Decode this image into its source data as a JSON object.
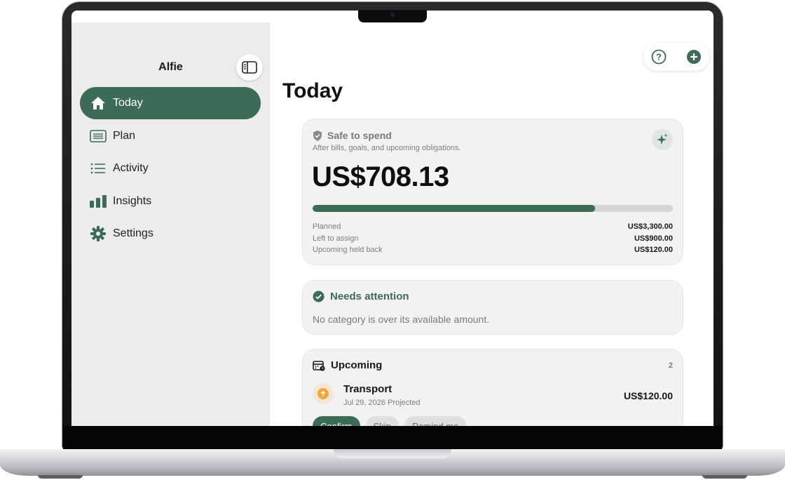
{
  "sidebar": {
    "title": "Alfie",
    "items": [
      {
        "label": "Today",
        "icon": "house-icon",
        "active": true
      },
      {
        "label": "Plan",
        "icon": "list-rect-icon",
        "active": false
      },
      {
        "label": "Activity",
        "icon": "list-bullets-icon",
        "active": false
      },
      {
        "label": "Insights",
        "icon": "bar-chart-icon",
        "active": false
      },
      {
        "label": "Settings",
        "icon": "gear-icon",
        "active": false
      }
    ]
  },
  "header": {
    "title": "Today"
  },
  "safe_to_spend": {
    "label": "Safe to spend",
    "subtitle": "After bills, goals, and upcoming obligations.",
    "amount": "US$708.13",
    "progress": 0.785,
    "rows": [
      {
        "label": "Planned",
        "value": "US$3,300.00"
      },
      {
        "label": "Left to assign",
        "value": "US$900.00"
      },
      {
        "label": "Upcoming held back",
        "value": "US$120.00"
      }
    ]
  },
  "attention": {
    "label": "Needs attention",
    "message": "No category is over its available amount."
  },
  "upcoming": {
    "label": "Upcoming",
    "count": "2",
    "item": {
      "name": "Transport",
      "meta": "Jul 29, 2026 Projected",
      "amount": "US$120.00"
    },
    "actions": {
      "confirm": "Confirm",
      "skip": "Skip",
      "remind": "Remind me"
    }
  },
  "colors": {
    "accent": "#3c6b56",
    "upcoming_dot": "#f0a540",
    "card": "#f2f2f2"
  }
}
